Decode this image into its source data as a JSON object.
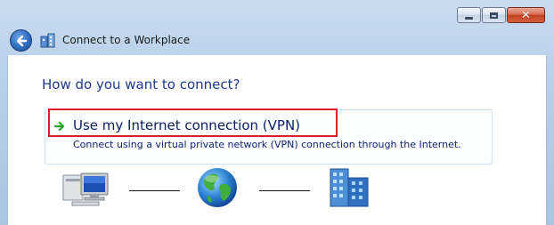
{
  "window": {
    "caption_buttons": {
      "minimize_icon": "minimize-icon",
      "maximize_icon": "maximize-icon",
      "close_icon": "close-icon",
      "close_glyph": "✕"
    },
    "back_icon": "back-arrow-icon",
    "title_icon": "workplace-icon",
    "title": "Connect to a Workplace"
  },
  "main": {
    "question": "How do you want to connect?",
    "option": {
      "arrow_icon": "green-arrow-icon",
      "title": "Use my Internet connection (VPN)",
      "description": "Connect using a virtual private network (VPN) connection through the Internet."
    },
    "illustration": {
      "icons": [
        "computer-icon",
        "globe-icon",
        "server-icon"
      ]
    }
  },
  "colors": {
    "title_text": "#1a1a1a",
    "question_text": "#1d3a8f",
    "option_title": "#0b1e62",
    "option_desc": "#0e2470",
    "highlight_border": "#d8202a",
    "arrow_green": "#2aa52a",
    "frame_blue": "#b9d1ea"
  }
}
